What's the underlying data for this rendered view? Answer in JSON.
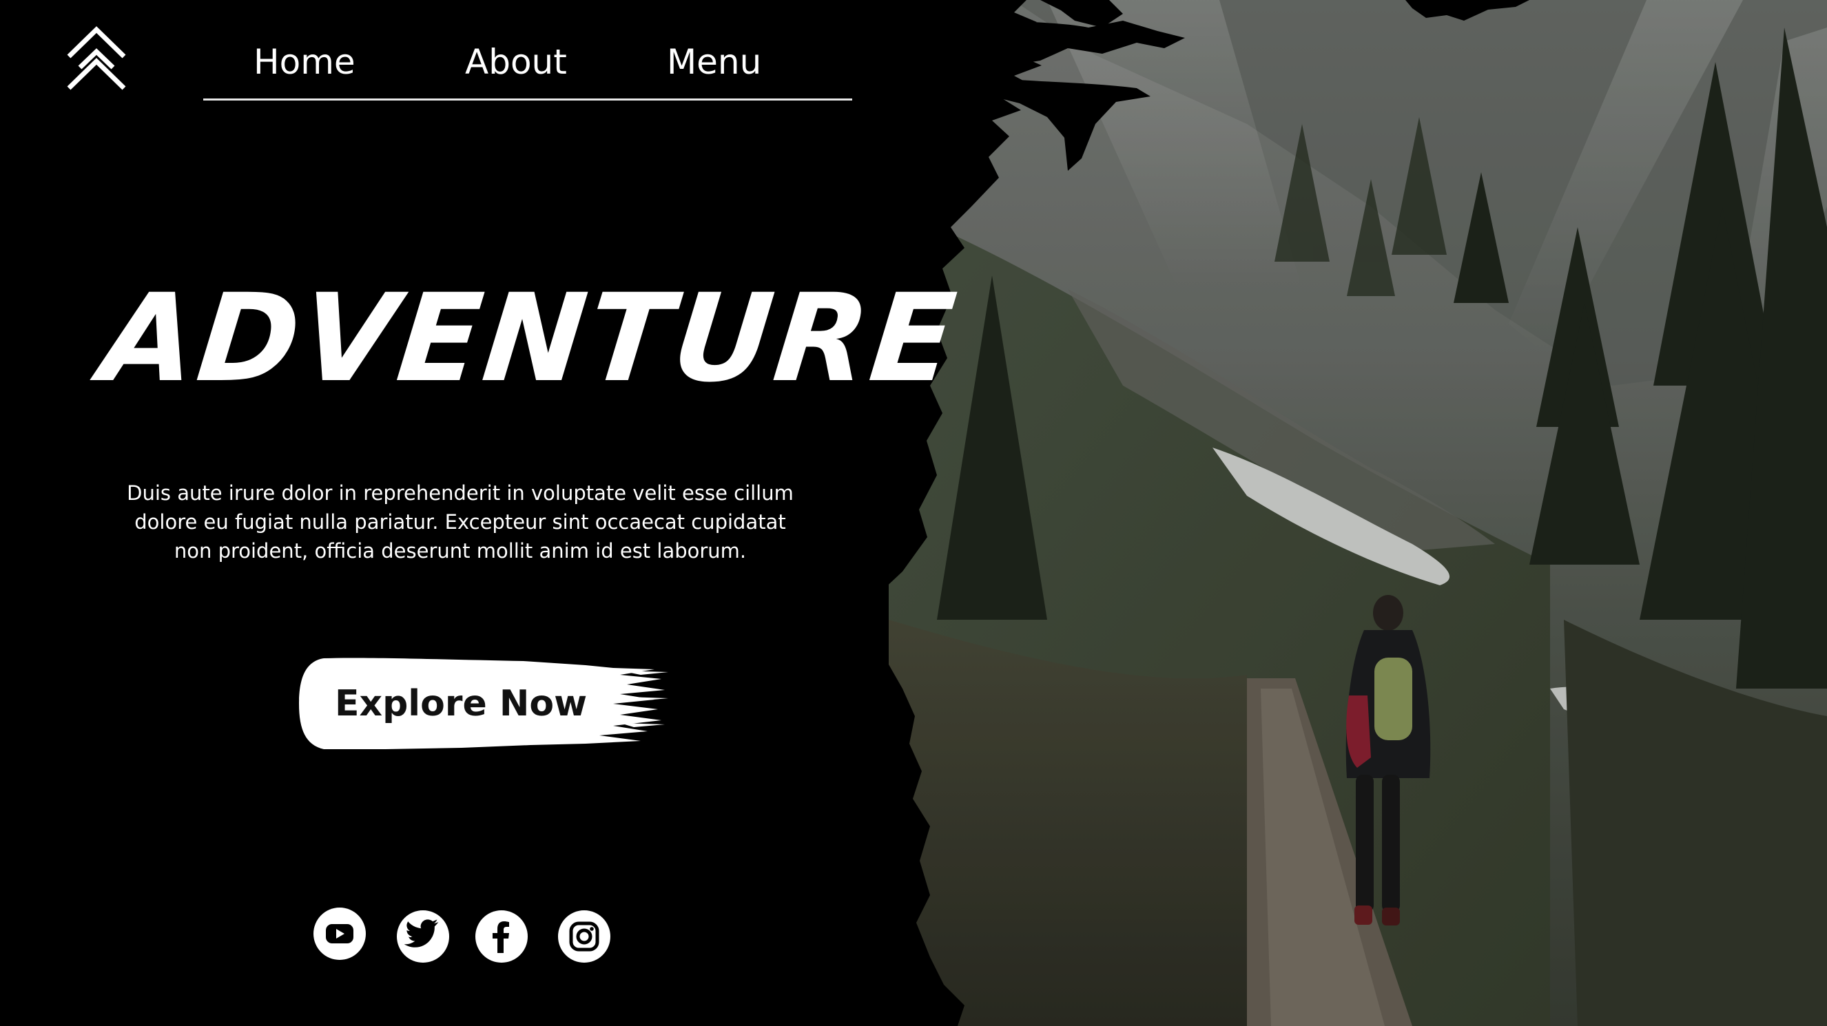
{
  "nav": {
    "home_label": "Home",
    "about_label": "About",
    "menu_label": "Menu"
  },
  "hero": {
    "headline": "ADVENTURE",
    "description": "Duis aute irure dolor in reprehenderit in voluptate velit esse cillum dolore eu fugiat nulla pariatur. Excepteur sint occaecat cupidatat non proident, officia deserunt mollit anim id est laborum.",
    "cta_label": "Explore Now"
  },
  "social": [
    "youtube-icon",
    "twitter-icon",
    "facebook-icon",
    "instagram-icon"
  ],
  "colors": {
    "background": "#000000",
    "text": "#ffffff",
    "cta_text": "#111111"
  }
}
